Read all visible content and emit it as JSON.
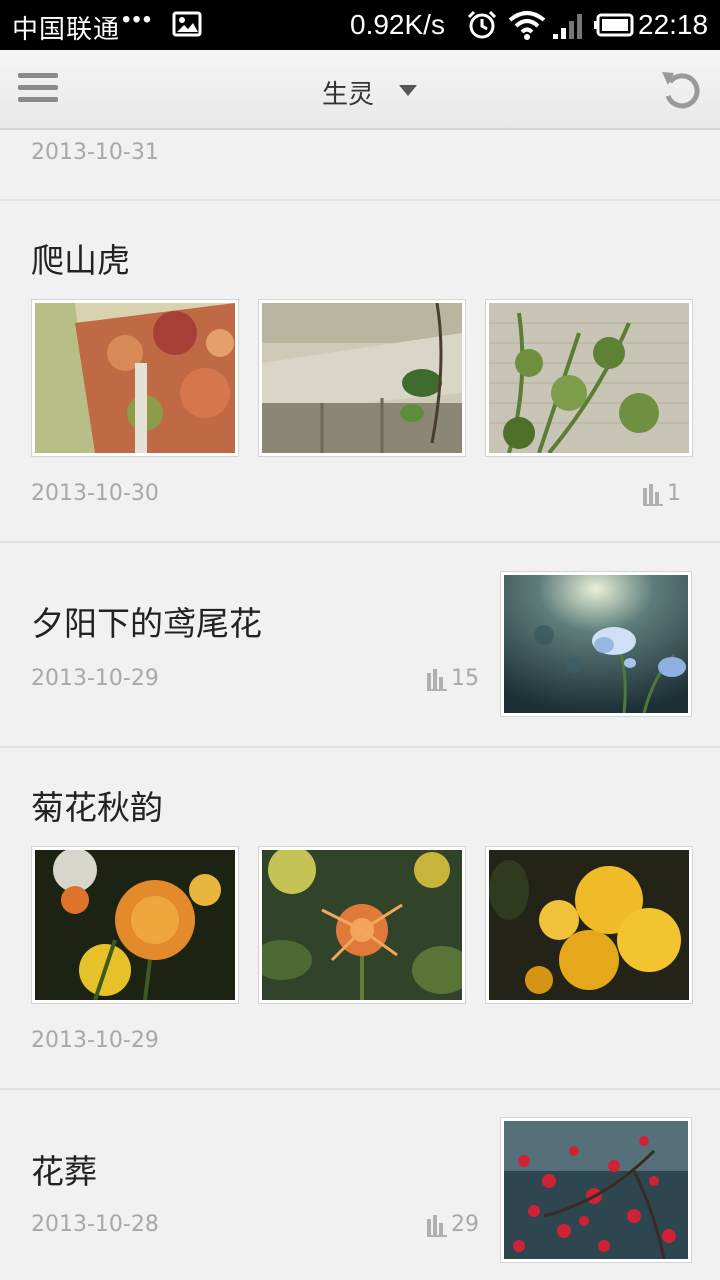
{
  "status_bar": {
    "carrier": "中国联通",
    "dots": "•••",
    "speed": "0.92K/s",
    "time": "22:18"
  },
  "action_bar": {
    "title": "生灵"
  },
  "posts": [
    {
      "date": "2013-10-31"
    },
    {
      "title": "爬山虎",
      "date": "2013-10-30",
      "count": "1"
    },
    {
      "title": "夕阳下的鸢尾花",
      "date": "2013-10-29",
      "count": "15"
    },
    {
      "title": "菊花秋韵",
      "date": "2013-10-29"
    },
    {
      "title": "花葬",
      "date": "2013-10-28",
      "count": "29"
    }
  ]
}
